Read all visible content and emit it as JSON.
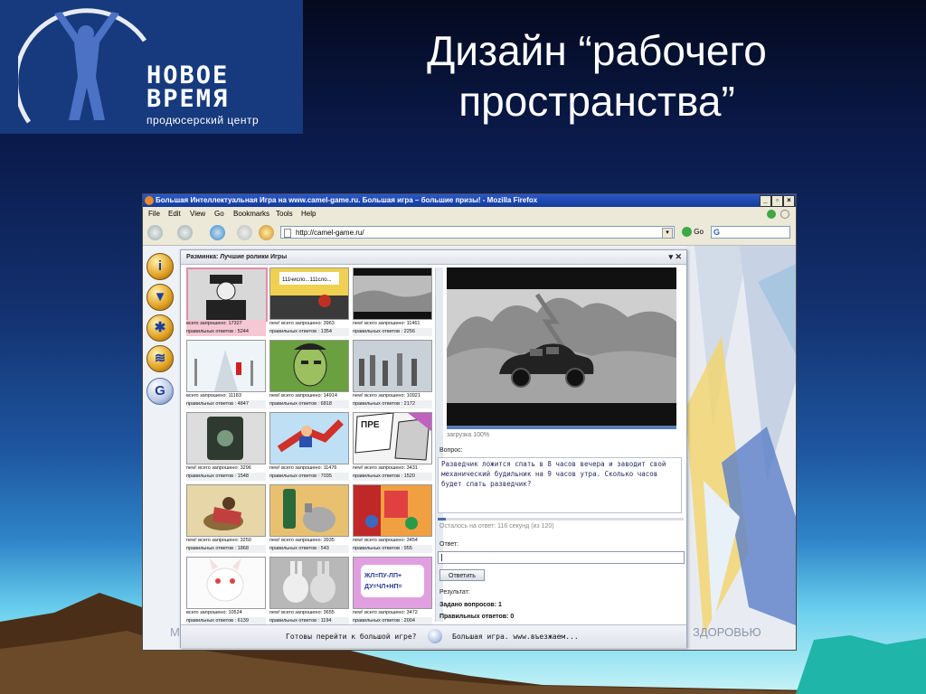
{
  "logo": {
    "line1": "НОВОЕ",
    "line2": "ВРЕМЯ",
    "subtitle": "продюсерский центр"
  },
  "slide": {
    "title_line1": "Дизайн “рабочего",
    "title_line2": "пространства”"
  },
  "browser": {
    "window_title": "Большая Интеллектуальная Игра на www.camel-game.ru. Большая игра – большие призы! - Mozilla Firefox",
    "menu": [
      "File",
      "Edit",
      "View",
      "Go",
      "Bookmarks",
      "Tools",
      "Help"
    ],
    "url": "http://camel-game.ru/",
    "go_label": "Go",
    "search_glyph": "G"
  },
  "panel": {
    "title": "Разминка: Лучшие ролики Игры",
    "controls": "▾ ✕"
  },
  "grid": [
    {
      "total": "всего запрошено: 17327",
      "correct": "правильных ответов : 5244"
    },
    {
      "total": "new! всего запрошено: 3963",
      "correct": "правильных ответов : 1354"
    },
    {
      "total": "new! всего запрошено: 11461",
      "correct": "правильных ответов : 2256"
    },
    {
      "total": "всего запрошено: 11183",
      "correct": "правильных ответов : 4847"
    },
    {
      "total": "new! всего запрошено: 14914",
      "correct": "правильных ответов : 6818"
    },
    {
      "total": "new! всего запрошено: 10921",
      "correct": "правильных ответов : 2172"
    },
    {
      "total": "new! всего запрошено: 3296",
      "correct": "правильных ответов : 1548"
    },
    {
      "total": "new! всего запрошено: 11476",
      "correct": "правильных ответов : 7035"
    },
    {
      "total": "new! всего запрошено: 3431",
      "correct": "правильных ответов : 1520"
    },
    {
      "total": "new! всего запрошено: 3250",
      "correct": "правильных ответов : 1868"
    },
    {
      "total": "new! всего запрошено: 3935",
      "correct": "правильных ответов : 543"
    },
    {
      "total": "new! всего запрошено: 3454",
      "correct": "правильных ответов : 955"
    },
    {
      "total": "всего запрошено: 10524",
      "correct": "правильных ответов : 6139"
    },
    {
      "total": "new! всего запрошено: 3655",
      "correct": "правильных ответов : 1194"
    },
    {
      "total": "new! всего запрошено: 3472",
      "correct": "правильных ответов : 2004"
    }
  ],
  "thumb_text": {
    "t1": "111число...111сло...",
    "t9": "ПРЕ",
    "t15a": "ЖЛ=ПУ-ЛП+",
    "t15b": "ДУ=ЧЛ+НП="
  },
  "video": {
    "loading": "загрузка 100%",
    "loading_progress": 1.0
  },
  "question": {
    "label": "Вопрос:",
    "text": "Разведчик ложится спать в 8 часов вечера и заводит свой механический будильник на 9 часов утра. Сколько часов будет спать разведчик?"
  },
  "timer": {
    "text": "Осталось на ответ: 116 секунд (из 120)",
    "remaining_seconds": 116,
    "total_seconds": 120
  },
  "answer": {
    "label": "Ответ:",
    "value": "",
    "button": "Ответить"
  },
  "result": {
    "label": "Результат:",
    "asked": "Задано вопросов: 1",
    "correct": "Правильных ответов: 0"
  },
  "bottom_bar": {
    "prompt": "Готовы перейти к большой игре?",
    "link": "Большая игра. www.въезжаем..."
  },
  "background_text": {
    "health": "ЗДОРОВЬЮ",
    "faded": "О",
    "left_letter": "М"
  },
  "colors": {
    "titlebar": "#2a58c8",
    "selection": "#f6c7d4",
    "progress": "#5a7fb8"
  }
}
